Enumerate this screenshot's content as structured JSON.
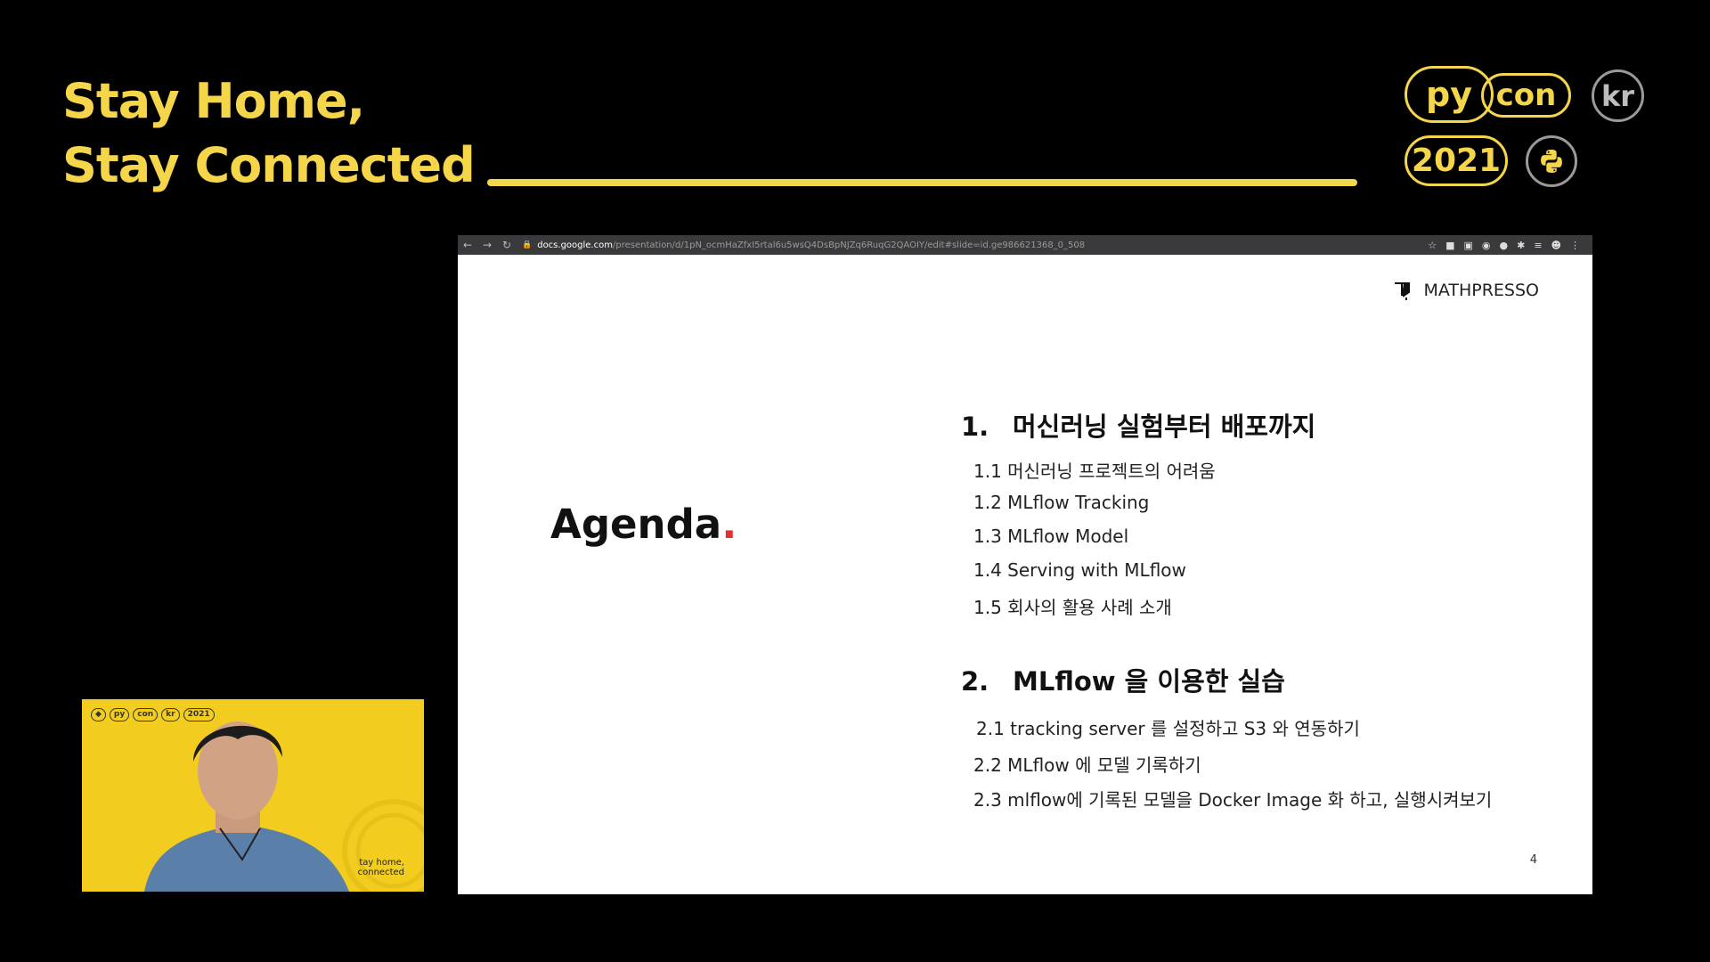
{
  "banner": {
    "headline_line1": "Stay Home,",
    "headline_line2": "Stay Connected",
    "badges": {
      "py": "py",
      "con": "con",
      "kr": "kr",
      "year": "2021"
    },
    "accent_color": "#f5d54a"
  },
  "browser": {
    "url_host": "docs.google.com",
    "url_path": "/presentation/d/1pN_ocmHaZfxI5rtal6u5wsQ4DsBpNJZq6RuqG2QAOIY/edit#slide=id.ge986621368_0_508",
    "icons": [
      "back-arrow-icon",
      "forward-arrow-icon",
      "reload-icon",
      "lock-icon",
      "star-icon",
      "extensions-icon",
      "profile-icon",
      "more-icon"
    ]
  },
  "slide": {
    "logo_text": "MATHPRESSO",
    "agenda_title": "Agenda",
    "agenda_dot": ".",
    "sections": [
      {
        "number": "1.",
        "title": "머신러닝 실험부터 배포까지",
        "items": [
          "1.1 머신러닝 프로젝트의 어려움",
          "1.2 MLflow Tracking",
          "1.3 MLflow Model",
          "1.4 Serving with MLflow",
          "1.5 회사의 활용 사례 소개"
        ]
      },
      {
        "number": "2.",
        "title": "MLflow 을 이용한 실습",
        "items": [
          "2.1 tracking server 를 설정하고 S3 와 연동하기",
          "2.2 MLflow 에 모델 기록하기",
          "2.3 mlflow에 기록된 모델을 Docker Image 화 하고, 실행시켜보기"
        ]
      }
    ],
    "page_number": "4"
  },
  "webcam": {
    "badges": [
      "py",
      "con",
      "kr",
      "2021"
    ],
    "caption_line1": "tay home,",
    "caption_line2": "connected"
  }
}
